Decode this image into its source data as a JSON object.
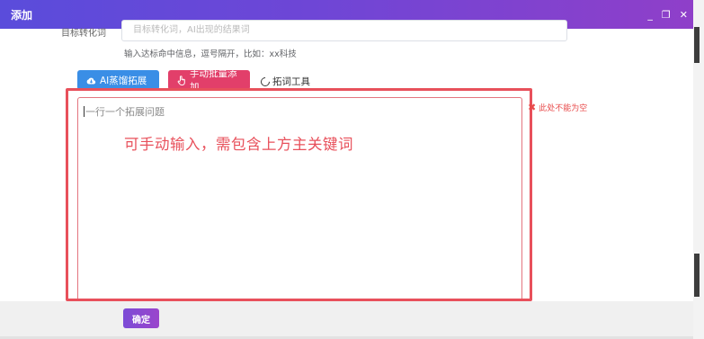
{
  "window": {
    "title": "添加",
    "controls": [
      "_",
      "❐",
      "✕"
    ]
  },
  "form": {
    "top_field_label": "目标转化词",
    "top_field_placeholder": "目标转化词，AI出现的结果词",
    "hint": "输入达标命中信息，逗号隔开，比如：xx科技"
  },
  "toolbar": {
    "ai_button": "AI蒸馏拓展",
    "manual_button": "手动批量添加",
    "tool_link": "拓词工具"
  },
  "editor": {
    "placeholder": "一行一个拓展问题",
    "annotation": "可手动输入，需包含上方主关键词",
    "error": "此处不能为空"
  },
  "footer": {
    "confirm_button": "确定"
  },
  "colors": {
    "titlebar_start": "#5a4cdb",
    "titlebar_end": "#8f3fc9",
    "ai_button": "#3a8ee6",
    "manual_button": "#e23f6a",
    "error": "#e8505b"
  }
}
